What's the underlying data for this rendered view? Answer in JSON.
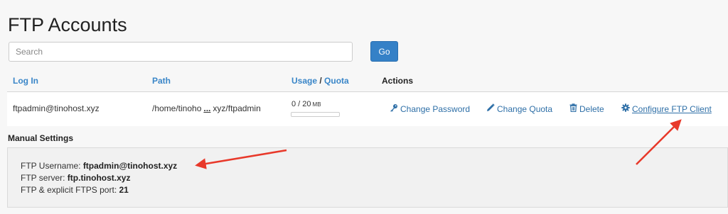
{
  "page": {
    "title": "FTP Accounts"
  },
  "search": {
    "placeholder": "Search",
    "go_label": "Go"
  },
  "table": {
    "headers": {
      "login": "Log In",
      "path": "Path",
      "usage": "Usage",
      "usage_sep": " / ",
      "quota": "Quota",
      "actions": "Actions"
    },
    "row": {
      "login": "ftpadmin@tinohost.xyz",
      "path_start": "/home/tinoho",
      "path_ellipsis": "...",
      "path_end": "xyz/ftpadmin",
      "usage_value": "0 / 20",
      "usage_unit": "MB",
      "usage_fraction": 0,
      "actions": {
        "change_password": "Change Password",
        "change_quota": "Change Quota",
        "delete": "Delete",
        "configure": "Configure FTP Client"
      }
    }
  },
  "manual": {
    "title": "Manual Settings",
    "username_label": "FTP Username: ",
    "username_value": "ftpadmin@tinohost.xyz",
    "server_label": "FTP server: ",
    "server_value": "ftp.tinohost.xyz",
    "port_label": "FTP & explicit FTPS port: ",
    "port_value": "21"
  },
  "icons": {
    "change_password": "key-icon",
    "change_quota": "pencil-icon",
    "delete": "trash-icon",
    "configure": "gear-icon"
  },
  "colors": {
    "link": "#2e6fa7",
    "header_link": "#3a86c8",
    "button": "#3581c7",
    "annotation_arrow": "#e8392a"
  }
}
